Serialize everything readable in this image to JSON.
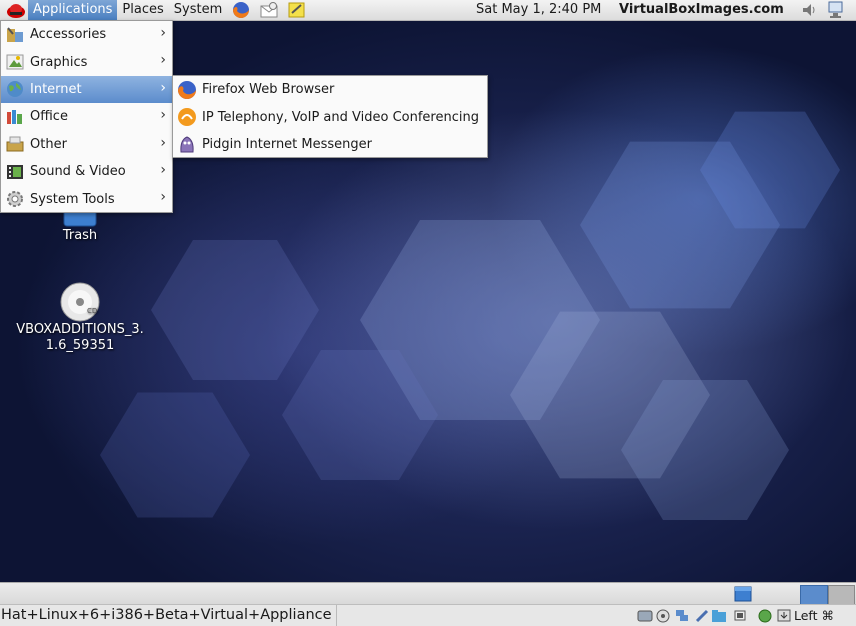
{
  "topbar": {
    "menus": [
      "Applications",
      "Places",
      "System"
    ],
    "clock": "Sat May  1,  2:40 PM",
    "brand": "VirtualBoxImages.com"
  },
  "apps_menu": {
    "items": [
      {
        "label": "Accessories",
        "icon": "accessories-icon"
      },
      {
        "label": "Graphics",
        "icon": "graphics-icon"
      },
      {
        "label": "Internet",
        "icon": "internet-globe-icon",
        "highlighted": true
      },
      {
        "label": "Office",
        "icon": "office-icon"
      },
      {
        "label": "Other",
        "icon": "other-icon"
      },
      {
        "label": "Sound & Video",
        "icon": "sound-video-icon"
      },
      {
        "label": "System Tools",
        "icon": "system-tools-icon"
      }
    ]
  },
  "internet_submenu": {
    "items": [
      {
        "label": "Firefox Web Browser",
        "icon": "firefox-icon"
      },
      {
        "label": "IP Telephony, VoIP and Video Conferencing",
        "icon": "ekiga-icon"
      },
      {
        "label": "Pidgin Internet Messenger",
        "icon": "pidgin-icon"
      }
    ]
  },
  "desktop": {
    "icons": [
      {
        "label": "Trash",
        "icon": "trash-icon"
      },
      {
        "label": "VBOXADDITIONS_3.\n1.6_59351",
        "icon": "cd-icon"
      }
    ]
  },
  "statusbar": {
    "window_title": "Hat+Linux+6+i386+Beta+Virtual+Appliance",
    "host_key": "Left ⌘"
  },
  "colors": {
    "menu_highlight": "#5b8ccc",
    "desktop_bg": "#1b2452"
  }
}
